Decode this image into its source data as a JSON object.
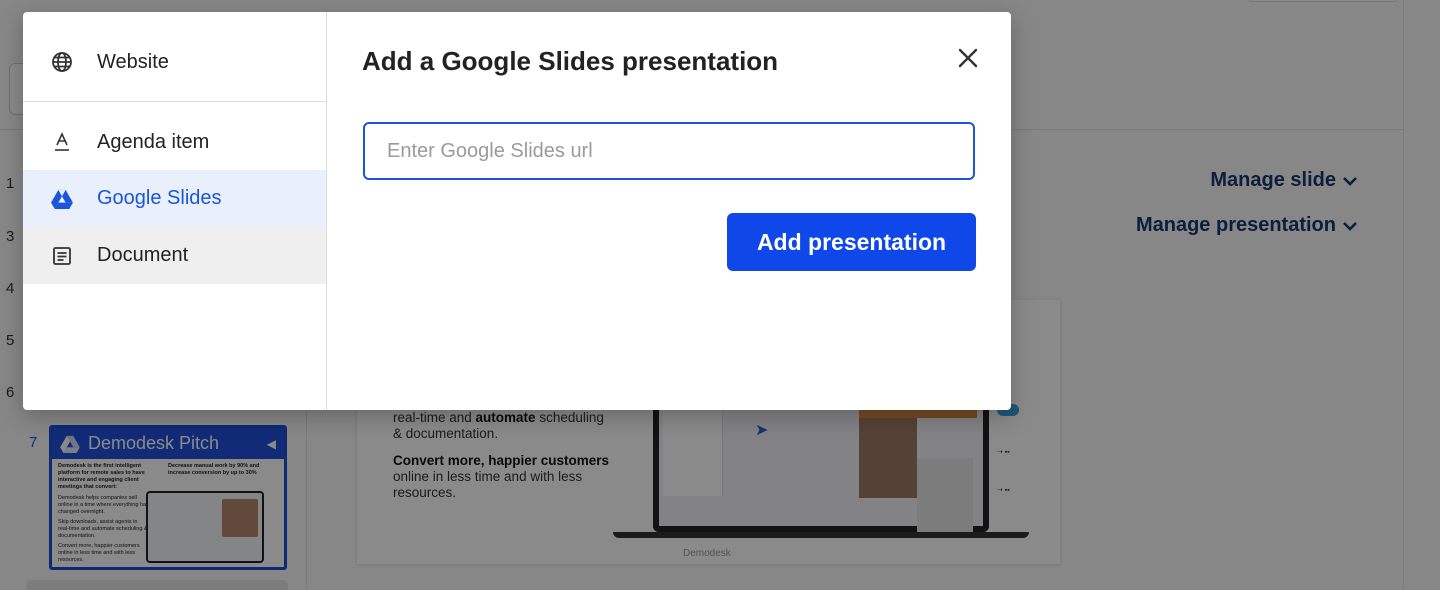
{
  "background": {
    "slide_numbers": [
      "1",
      "3",
      "4",
      "5",
      "6"
    ],
    "active_slide_number": "7",
    "thumbnail": {
      "title": "Demodesk Pitch",
      "col1_text": "Demodesk is the first intelligent platform for remote sales to have interactive and engaging client meetings that convert:",
      "col2_text": "Decrease manual work by 90% and increase conversion by up to 30%",
      "bullets": [
        "Demodesk helps companies sell online in a time where everything has changed overnight.",
        "Skip downloads, assist agents in real-time and automate scheduling & documentation.",
        "Convert more, happier customers online in less time and with less resources."
      ]
    },
    "slide": {
      "text_line1": "real-time and ",
      "text_bold1": "automate",
      "text_line1b": " scheduling & documentation.",
      "bold_heading": "Convert more, happier customers",
      "text_line2": "online in less time and with less resources.",
      "brand": "Demodesk"
    },
    "manage_slide": "Manage slide",
    "manage_presentation": "Manage presentation"
  },
  "modal": {
    "sidebar": {
      "items": [
        {
          "label": "Website",
          "icon": "globe-icon"
        },
        {
          "label": "Agenda item",
          "icon": "text-format-icon"
        },
        {
          "label": "Google Slides",
          "icon": "google-drive-icon",
          "selected": true
        },
        {
          "label": "Document",
          "icon": "document-icon"
        }
      ]
    },
    "title": "Add a Google Slides presentation",
    "url_input": {
      "placeholder": "Enter Google Slides url",
      "value": ""
    },
    "submit_label": "Add presentation",
    "close_icon": "close-icon"
  },
  "colors": {
    "accent": "#1047e8",
    "selected_bg": "#e9effb",
    "selected_text": "#1a56db",
    "link_dark": "#17386e"
  }
}
